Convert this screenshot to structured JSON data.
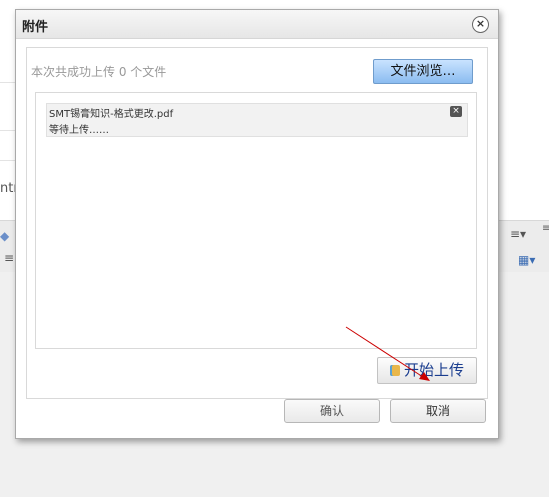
{
  "background": {
    "text_fragment": "ntr"
  },
  "dialog": {
    "title": "附件",
    "close_glyph": "×",
    "upload_status": "本次共成功上传 0 个文件",
    "browse_label": "文件浏览…",
    "files": [
      {
        "name": "SMT锡膏知识-格式更改.pdf",
        "status": "等待上传……",
        "remove_glyph": "×"
      }
    ],
    "start_upload_label": "开始上传",
    "confirm_label": "确认",
    "cancel_label": "取消"
  },
  "colors": {
    "browse_button": "#8bbcf0",
    "annotation_arrow": "#cc0000"
  }
}
